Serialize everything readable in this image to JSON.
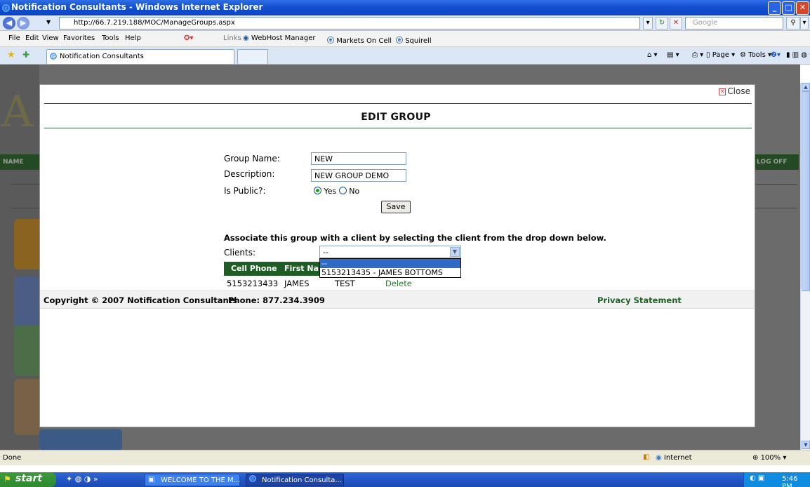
{
  "window": {
    "title": "Notification Consultants - Windows Internet Explorer"
  },
  "addressbar": {
    "url": "http://66.7.219.188/MOC/ManageGroups.aspx",
    "search_placeholder": "Google"
  },
  "menubar": {
    "items": [
      "File",
      "Edit",
      "View",
      "Favorites",
      "Tools",
      "Help"
    ],
    "links_label": "Links",
    "links": [
      "WebHost Manager",
      "Markets On Cell",
      "Squirell"
    ]
  },
  "tabs": {
    "active_tab": "Notification Consultants",
    "commands": [
      "Page",
      "Tools"
    ]
  },
  "background": {
    "nav_left": "NAME",
    "nav_right": "LOG OFF",
    "logo_letter": "A"
  },
  "modal": {
    "close_label": "Close",
    "heading": "EDIT GROUP",
    "form": {
      "group_name_label": "Group Name:",
      "group_name_value": "NEW",
      "description_label": "Description:",
      "description_value": "NEW GROUP DEMO",
      "is_public_label": "Is Public?:",
      "yes_label": "Yes",
      "no_label": "No",
      "save_label": "Save"
    },
    "associate_text": "Associate this group with a client by selecting the client from the drop down below.",
    "clients_label": "Clients:",
    "clients_selected": "--",
    "dropdown_options": [
      "--",
      "5153213435 - JAMES BOTTOMS"
    ],
    "table": {
      "headers": [
        "Cell Phone",
        "First Nar"
      ],
      "rows": [
        {
          "cell": "5153213433",
          "first": "JAMES",
          "last": "TEST",
          "action": "Delete"
        }
      ]
    },
    "footer": {
      "copyright": "Copyright © 2007 Notification Consultants",
      "phone": "Phone: 877.234.3909",
      "privacy": "Privacy Statement"
    }
  },
  "statusbar": {
    "status": "Done",
    "zone": "Internet",
    "zoom": "100%"
  },
  "taskbar": {
    "start": "start",
    "tasks": [
      "WELCOME TO THE M...",
      "Notification Consulta..."
    ],
    "clock": "5:46 PM"
  }
}
